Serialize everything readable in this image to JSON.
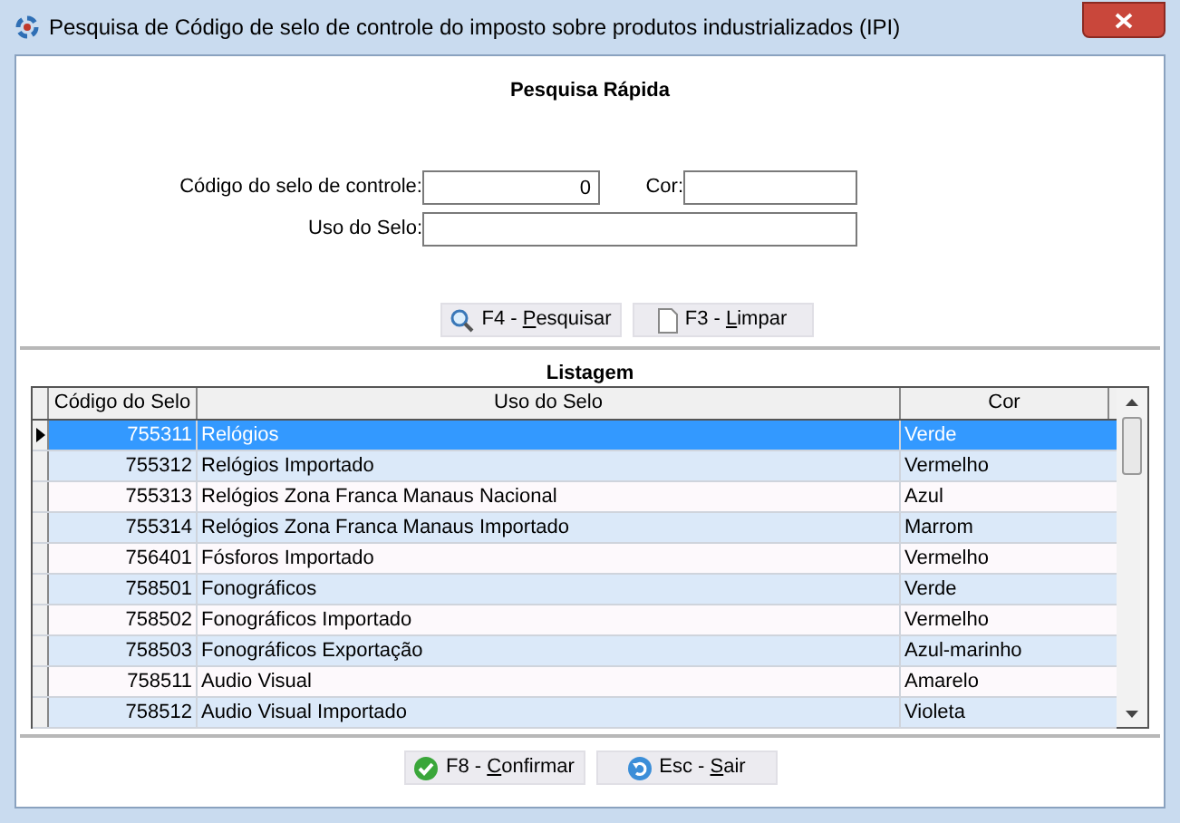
{
  "window": {
    "title": "Pesquisa de Código de selo de controle do imposto sobre produtos industrializados (IPI)"
  },
  "quick_search": {
    "title": "Pesquisa Rápida",
    "fields": [
      {
        "label": "Código do selo de controle:",
        "value": "0"
      },
      {
        "label": "Cor:"
      },
      {
        "label": "Uso do Selo:"
      }
    ],
    "buttons": [
      {
        "kind": "search",
        "prefix": "F4 - ",
        "accel": "P",
        "rest": "esquisar"
      },
      {
        "kind": "clear",
        "prefix": "F3 - ",
        "accel": "L",
        "rest": "impar"
      }
    ]
  },
  "listing": {
    "title": "Listagem",
    "columns": [
      "Código do Selo",
      "Uso do Selo",
      "Cor"
    ],
    "rows": [
      {
        "code": "755311",
        "use": "Relógios",
        "cor": "Verde",
        "selected": true
      },
      {
        "code": "755312",
        "use": "Relógios Importado",
        "cor": "Vermelho",
        "selected": false
      },
      {
        "code": "755313",
        "use": "Relógios Zona Franca Manaus Nacional",
        "cor": "Azul",
        "selected": false
      },
      {
        "code": "755314",
        "use": "Relógios Zona Franca Manaus Importado",
        "cor": "Marrom",
        "selected": false
      },
      {
        "code": "756401",
        "use": "Fósforos Importado",
        "cor": "Vermelho",
        "selected": false
      },
      {
        "code": "758501",
        "use": "Fonográficos",
        "cor": "Verde",
        "selected": false
      },
      {
        "code": "758502",
        "use": "Fonográficos Importado",
        "cor": "Vermelho",
        "selected": false
      },
      {
        "code": "758503",
        "use": "Fonográficos Exportação",
        "cor": "Azul-marinho",
        "selected": false
      },
      {
        "code": "758511",
        "use": "Audio Visual",
        "cor": "Amarelo",
        "selected": false
      },
      {
        "code": "758512",
        "use": "Audio Visual Importado",
        "cor": "Violeta",
        "selected": false
      }
    ]
  },
  "footer_buttons": [
    {
      "kind": "confirm",
      "prefix": "F8 - ",
      "accel": "C",
      "rest": "onfirmar"
    },
    {
      "kind": "exit",
      "prefix": "Esc - ",
      "accel": "S",
      "rest": "air"
    }
  ]
}
